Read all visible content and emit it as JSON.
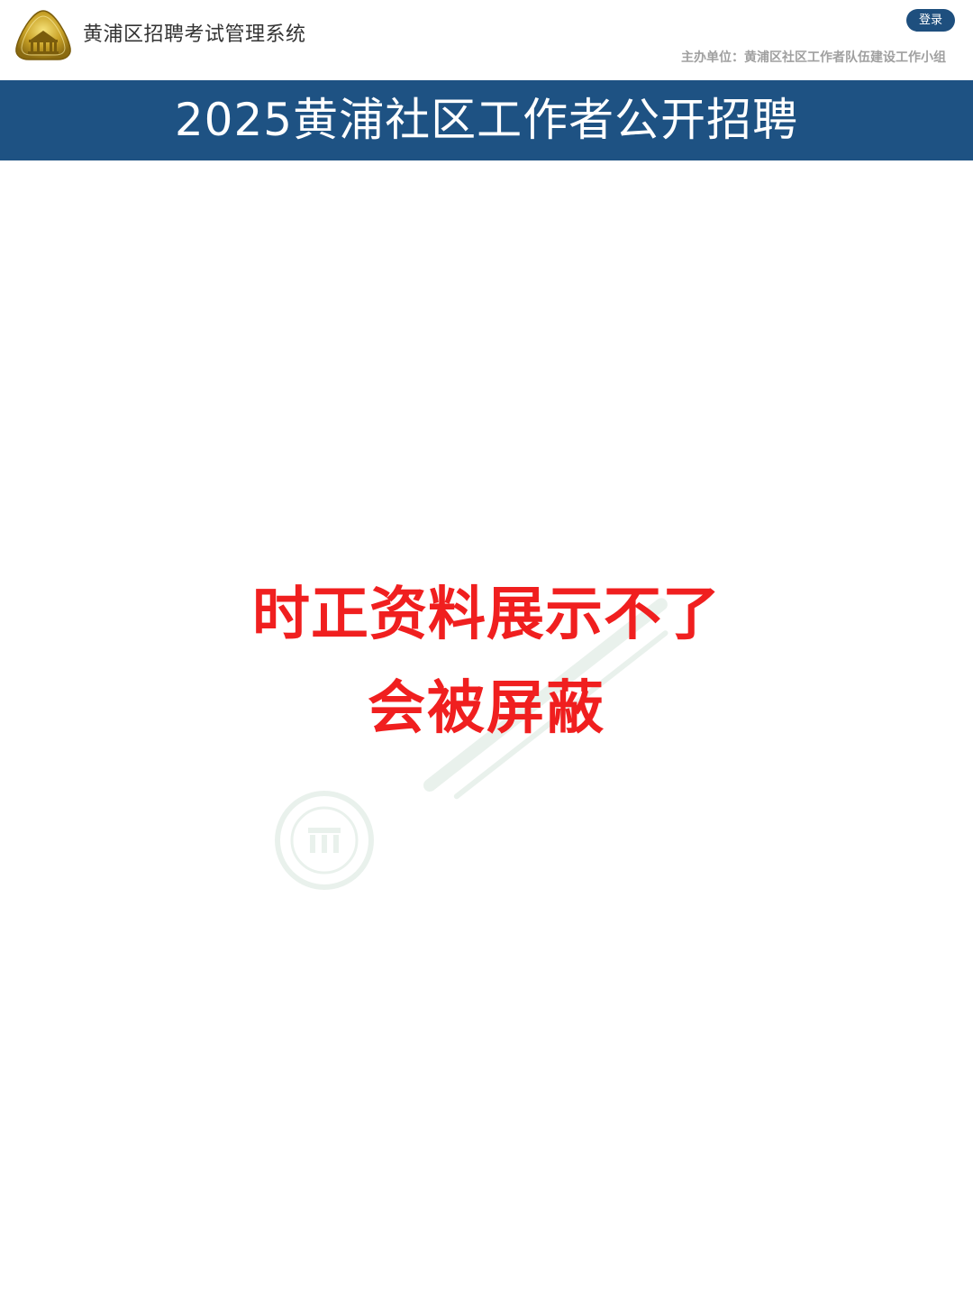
{
  "header": {
    "logo_icon": "gold-building-emblem-icon",
    "system_title": "黄浦区招聘考试管理系统",
    "login_label": "登录",
    "organizer_label": "主办单位：",
    "organizer_name": "黄浦区社区工作者队伍建设工作小组"
  },
  "banner": {
    "title": "2025黄浦社区工作者公开招聘"
  },
  "notice": {
    "line1": "时正资料展示不了",
    "line2": "会被屏蔽"
  },
  "watermark": {
    "icon": "university-seal-watermark-icon"
  },
  "colors": {
    "banner_bg": "#1e5283",
    "login_bg": "#1e4f7e",
    "notice_text": "#f01f1f",
    "organizer_text": "#a0a0a0"
  }
}
